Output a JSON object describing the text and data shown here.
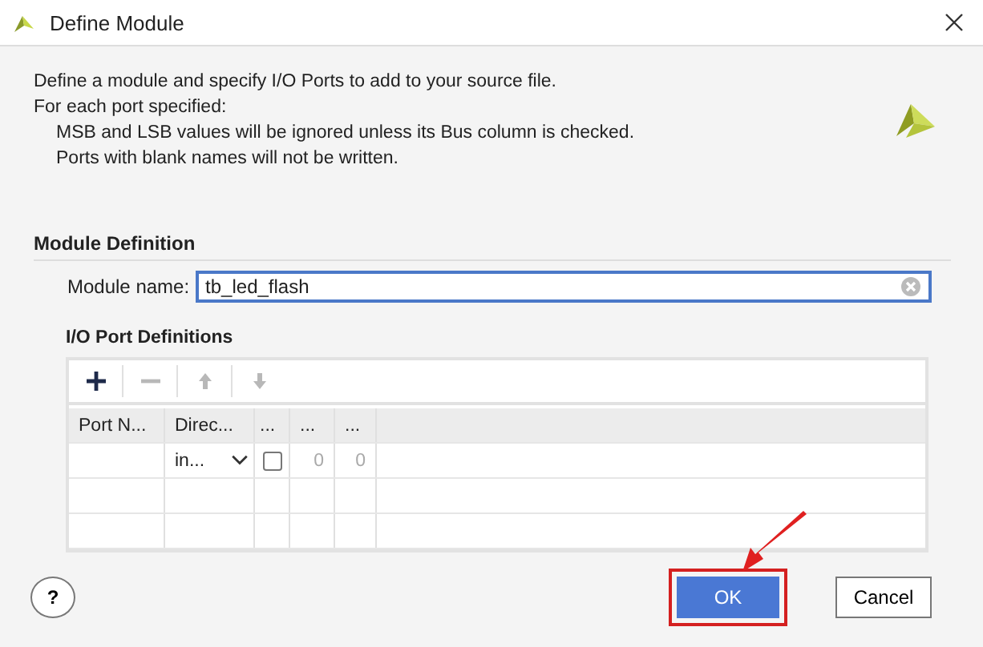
{
  "window": {
    "title": "Define Module"
  },
  "intro": {
    "lines": [
      {
        "text": "Define a module and specify I/O Ports to add to your source file.",
        "indented": false
      },
      {
        "text": "For each port specified:",
        "indented": false
      },
      {
        "text": "MSB and LSB values will be ignored unless its Bus column is checked.",
        "indented": true
      },
      {
        "text": "Ports with blank names will not be written.",
        "indented": true
      }
    ]
  },
  "module_definition": {
    "heading": "Module Definition",
    "module_name": {
      "label": "Module name:",
      "value": "tb_led_flash"
    }
  },
  "io_ports": {
    "heading": "I/O Port Definitions",
    "toolbar": [
      {
        "kind": "add",
        "disabled": false
      },
      {
        "kind": "remove",
        "disabled": true
      },
      {
        "kind": "up",
        "disabled": true
      },
      {
        "kind": "down",
        "disabled": true
      }
    ],
    "columns": [
      "Port N...",
      "Direc...",
      "...",
      "...",
      "..."
    ],
    "rows": [
      {
        "direction": "in...",
        "bus_checked": false,
        "msb": "0",
        "lsb": "0"
      }
    ]
  },
  "buttons": [
    {
      "kind": "help",
      "label": "?",
      "highlighted": false
    },
    {
      "kind": "ok",
      "label": "OK",
      "highlighted": true
    },
    {
      "kind": "cancel",
      "label": "Cancel",
      "highlighted": false
    }
  ]
}
